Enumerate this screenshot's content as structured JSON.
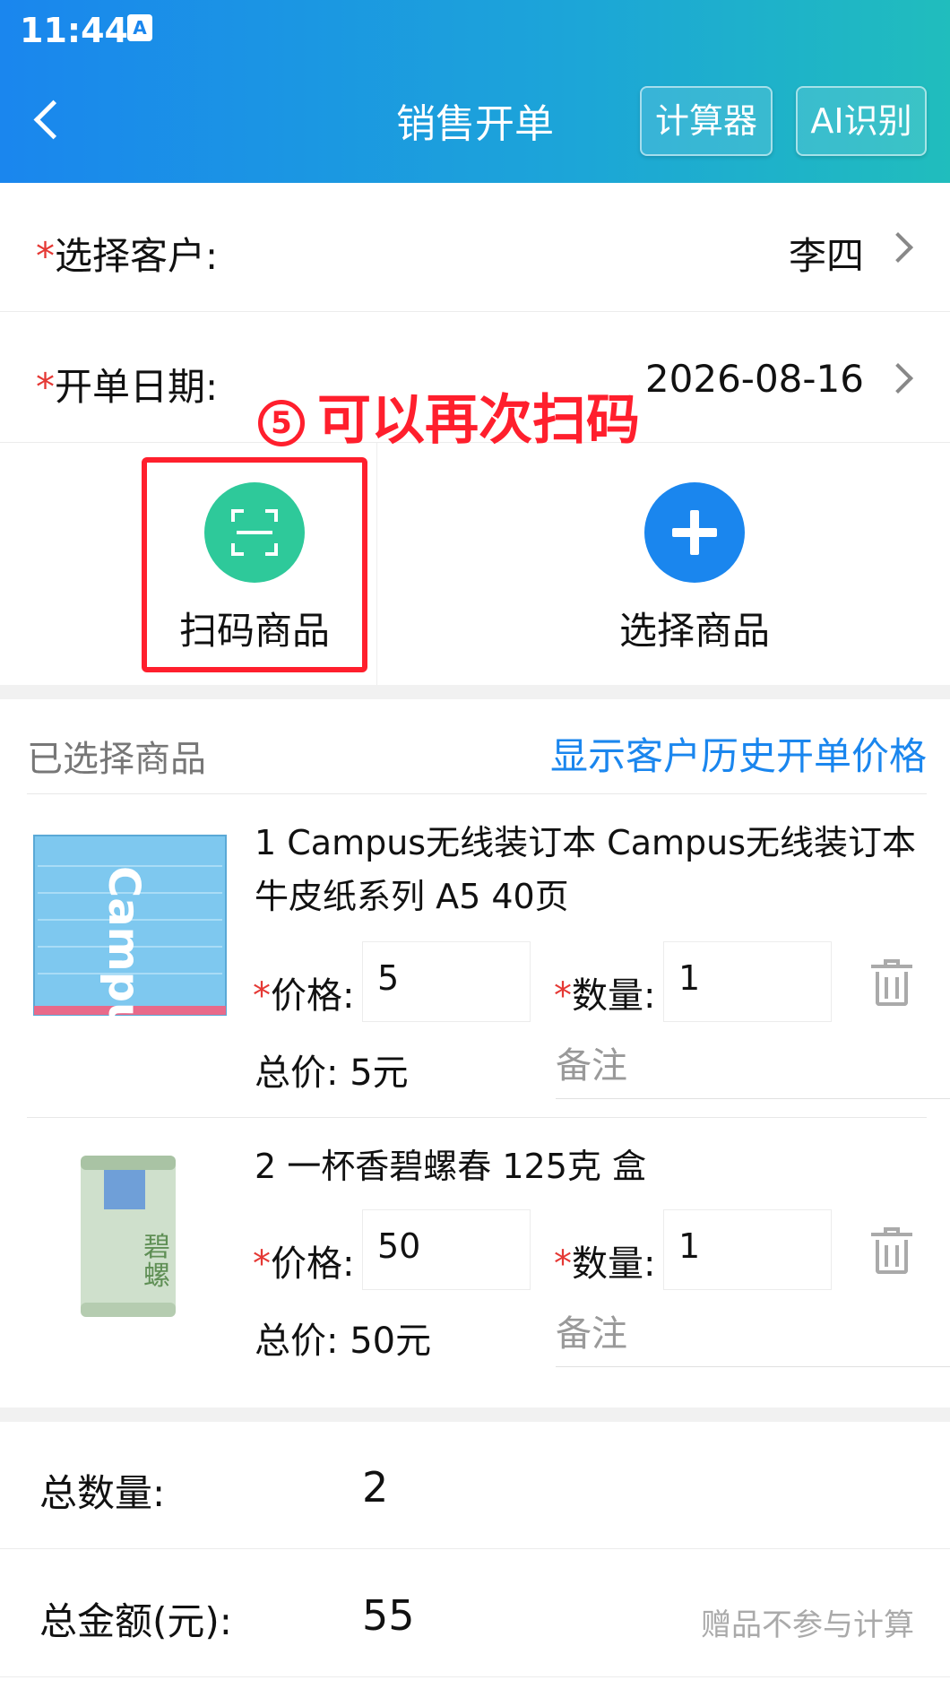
{
  "status_bar": {
    "time": "11:44",
    "icon": "A"
  },
  "header": {
    "title": "销售开单",
    "calculator_label": "计算器",
    "ai_label": "AI识别"
  },
  "form": {
    "customer": {
      "required_mark": "*",
      "label": "选择客户:",
      "value": "李四"
    },
    "date": {
      "required_mark": "*",
      "label": "开单日期:",
      "value": "2026-08-16"
    }
  },
  "actions": {
    "scan_label": "扫码商品",
    "select_label": "选择商品"
  },
  "annotation": {
    "number": "5",
    "text": "可以再次扫码"
  },
  "list": {
    "title": "已选择商品",
    "history_link": "显示客户历史开单价格",
    "price_label": "价格:",
    "qty_label": "数量:",
    "required_mark": "*",
    "remark_placeholder": "备注",
    "items": [
      {
        "name": "1 Campus无线装订本 Campus无线装订本 牛皮纸系列 A5 40页",
        "price": "5",
        "qty": "1",
        "total": "总价: 5元"
      },
      {
        "name": "2 一杯香碧螺春 125克 盒",
        "price": "50",
        "qty": "1",
        "total": "总价: 50元"
      }
    ]
  },
  "totals": {
    "qty_label": "总数量:",
    "qty_value": "2",
    "amount_label": "总金额(元):",
    "amount_value": "55",
    "gift_note": "赠品不参与计算"
  },
  "colors": {
    "accent": "#1a86ee",
    "scan_green": "#2ec99a",
    "annotation_red": "#ff1f2d",
    "required_red": "#e53935"
  }
}
